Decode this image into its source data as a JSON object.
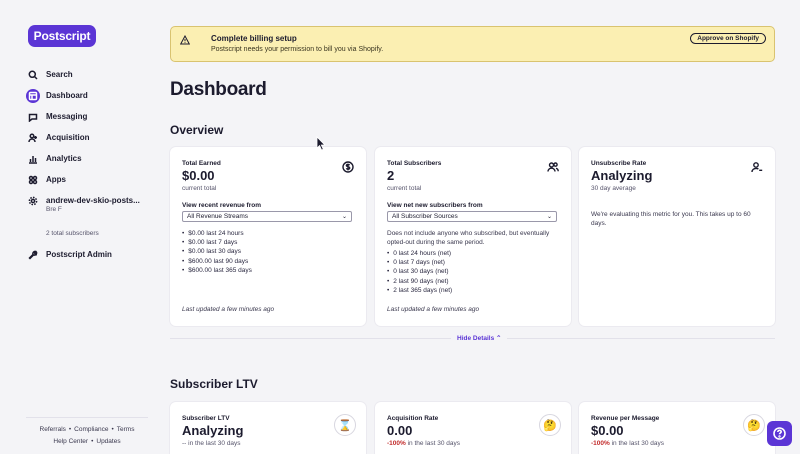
{
  "brand": {
    "logo_text": "Postscript",
    "accent": "#5b35d5"
  },
  "sidebar": {
    "items": [
      {
        "label": "Search",
        "icon": "search-icon"
      },
      {
        "label": "Dashboard",
        "icon": "dashboard-icon",
        "active": true
      },
      {
        "label": "Messaging",
        "icon": "message-icon"
      },
      {
        "label": "Acquisition",
        "icon": "acquisition-icon"
      },
      {
        "label": "Analytics",
        "icon": "analytics-icon"
      },
      {
        "label": "Apps",
        "icon": "apps-icon"
      },
      {
        "label": "andrew-dev-skio-posts...",
        "icon": "gear-icon"
      }
    ],
    "account_user": "Bre F",
    "subscriber_count": "2 total subscribers",
    "admin_label": "Postscript Admin",
    "footer": {
      "referrals": "Referrals",
      "compliance": "Compliance",
      "terms": "Terms",
      "help_center": "Help Center",
      "updates": "Updates"
    }
  },
  "banner": {
    "title": "Complete billing setup",
    "description": "Postscript needs your permission to bill you via Shopify.",
    "button": "Approve on Shopify"
  },
  "page_title": "Dashboard",
  "overview": {
    "title": "Overview",
    "cards": [
      {
        "label": "Total Earned",
        "value": "$0.00",
        "sub": "current total",
        "view_label": "View recent revenue from",
        "select": "All Revenue Streams",
        "items": [
          "$0.00 last 24 hours",
          "$0.00 last 7 days",
          "$0.00 last 30 days",
          "$600.00 last 90 days",
          "$600.00 last 365 days"
        ],
        "updated": "Last updated a few minutes ago"
      },
      {
        "label": "Total Subscribers",
        "value": "2",
        "sub": "current total",
        "view_label": "View net new subscribers from",
        "select": "All Subscriber Sources",
        "note": "Does not include anyone who subscribed, but eventually opted-out during the same period.",
        "items": [
          "0 last 24 hours (net)",
          "0 last 7 days (net)",
          "0 last 30 days (net)",
          "2 last 90 days (net)",
          "2 last 365 days (net)"
        ],
        "updated": "Last updated a few minutes ago"
      },
      {
        "label": "Unsubscribe Rate",
        "value": "Analyzing",
        "sub": "30 day average",
        "note": "We're evaluating this metric for you. This takes up to 60 days."
      }
    ],
    "hide_details": "Hide Details"
  },
  "ltv": {
    "title": "Subscriber LTV",
    "cards": [
      {
        "label": "Subscriber LTV",
        "value": "Analyzing",
        "change": "--",
        "suffix": " in the last 30 days",
        "emoji": "⌛"
      },
      {
        "label": "Acquisition Rate",
        "value": "0.00",
        "change": "-100%",
        "suffix": " in the last 30 days",
        "emoji": "🤔"
      },
      {
        "label": "Revenue per Message",
        "value": "$0.00",
        "change": "-100%",
        "suffix": " in the last 30 days",
        "emoji": "🤔"
      }
    ]
  }
}
